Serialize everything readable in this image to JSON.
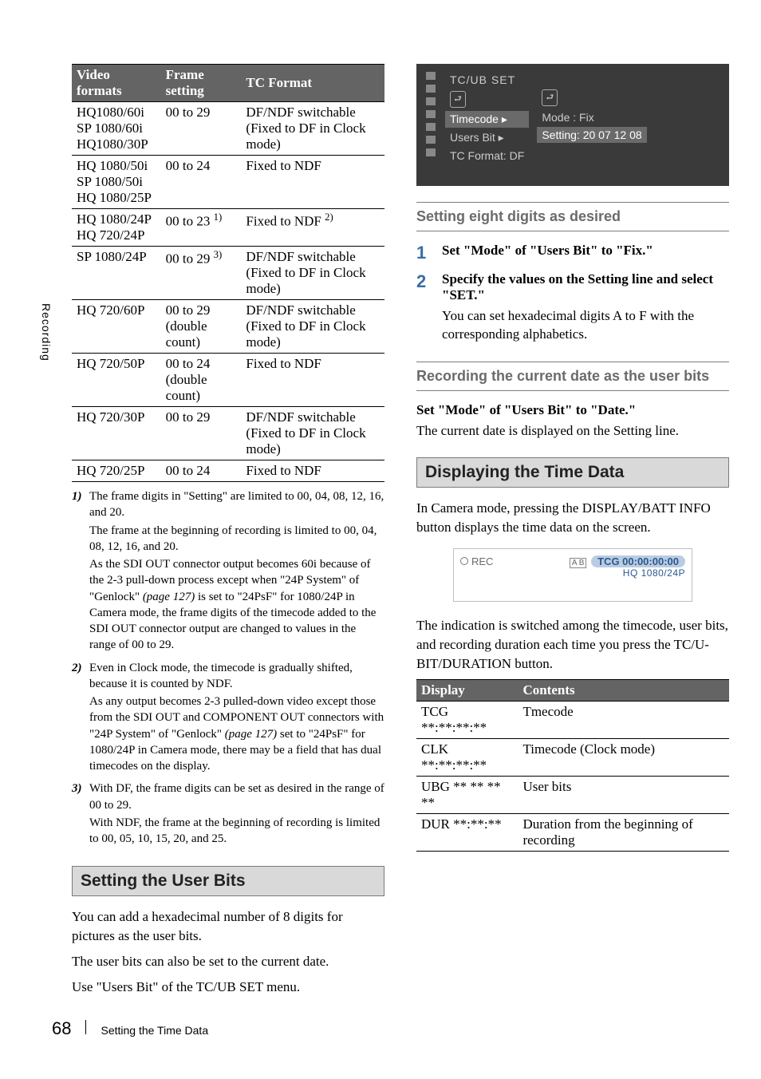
{
  "side_label": "Recording",
  "table1": {
    "headers": [
      "Video formats",
      "Frame setting",
      "TC Format"
    ],
    "rows": [
      {
        "c0": "HQ1080/60i\nSP 1080/60i\nHQ1080/30P",
        "c1": "00 to 29",
        "c2": "DF/NDF switchable\n(Fixed to DF in Clock mode)"
      },
      {
        "c0": "HQ 1080/50i\nSP 1080/50i\nHQ 1080/25P",
        "c1": "00 to 24",
        "c2": "Fixed to NDF"
      },
      {
        "c0": "HQ 1080/24P\nHQ 720/24P",
        "c1": "00 to 23",
        "c1_sup": "1)",
        "c2": "Fixed to NDF",
        "c2_sup": "2)"
      },
      {
        "c0": "SP 1080/24P",
        "c1": "00 to 29",
        "c1_sup": "3)",
        "c2": "DF/NDF switchable\n(Fixed to DF in Clock mode)"
      },
      {
        "c0": "HQ 720/60P",
        "c1": "00 to 29\n(double count)",
        "c2": "DF/NDF switchable\n(Fixed to DF in Clock mode)"
      },
      {
        "c0": "HQ 720/50P",
        "c1": "00 to 24\n(double count)",
        "c2": "Fixed to NDF"
      },
      {
        "c0": "HQ 720/30P",
        "c1": "00 to 29",
        "c2": "DF/NDF switchable\n(Fixed to DF in Clock mode)"
      },
      {
        "c0": "HQ 720/25P",
        "c1": "00 to 24",
        "c2": "Fixed to NDF"
      }
    ]
  },
  "footnotes": [
    {
      "num": "1)",
      "paras": [
        "The frame digits in \"Setting\" are limited to 00, 04, 08, 12, 16, and 20.",
        "The frame at the beginning of recording is limited to 00, 04, 08, 12, 16, and 20.",
        "As the SDI OUT connector output becomes 60i because of the 2-3 pull-down process except when \"24P System\" of \"Genlock\" (page 127) is set to \"24PsF\" for 1080/24P in Camera mode, the frame digits of the timecode added to the SDI OUT connector output are changed to values in the range of 00 to 29."
      ]
    },
    {
      "num": "2)",
      "paras": [
        "Even in Clock mode, the timecode is gradually shifted, because it is counted by NDF.",
        "As any output becomes 2-3 pulled-down video except those from the SDI OUT and COMPONENT OUT connectors with \"24P System\" of \"Genlock\" (page 127) set to \"24PsF\" for 1080/24P in Camera mode, there may be a field that has dual timecodes on the display."
      ]
    },
    {
      "num": "3)",
      "paras": [
        "With DF, the frame digits can be set as desired in the range of 00 to 29.",
        "With NDF, the frame at the beginning of recording is limited to 00, 05, 10, 15, 20, and 25."
      ]
    }
  ],
  "section_user_bits": {
    "title": "Setting the User Bits",
    "p1": "You can add a hexadecimal number of 8 digits for pictures as the user bits.",
    "p2": "The user bits can also be set to the current date.",
    "p3": "Use \"Users Bit\" of the TC/UB SET menu."
  },
  "camera_menu": {
    "title": "TC/UB SET",
    "left": [
      "⮐",
      "Timecode  ▸",
      "Users Bit ▸",
      "TC Format: DF"
    ],
    "right": [
      "⮐",
      "Mode    : Fix",
      "Setting: 20 07 12 08"
    ]
  },
  "subhead_eight": "Setting eight digits as desired",
  "steps": [
    {
      "num": "1",
      "head": "Set \"Mode\" of \"Users Bit\" to \"Fix.\""
    },
    {
      "num": "2",
      "head": "Specify the values on the Setting line and select \"SET.\"",
      "body": "You can set hexadecimal digits A to F with the corresponding alphabetics."
    }
  ],
  "subhead_record": "Recording the current date as the user bits",
  "record_block": {
    "line1": "Set \"Mode\" of \"Users Bit\" to \"Date.\"",
    "line2": "The current date is displayed on the Setting line."
  },
  "section_display": {
    "title": "Displaying the Time Data",
    "p1": "In Camera mode, pressing the DISPLAY/BATT INFO button displays the time data on the screen."
  },
  "display_box": {
    "rec": "REC",
    "ab": "A B",
    "tcg": "TCG 00:00:00:00",
    "mode": "HQ 1080/24P"
  },
  "display_switch_text": "The indication is switched among the timecode, user bits, and recording duration each time you press the TC/U-BIT/DURATION button.",
  "display_table": {
    "headers": [
      "Display",
      "Contents"
    ],
    "rows": [
      {
        "c0": "TCG **:**:**:**",
        "c1": "Tmecode"
      },
      {
        "c0": "CLK **:**:**:**",
        "c1": "Timecode (Clock mode)"
      },
      {
        "c0": "UBG ** ** ** **",
        "c1": "User bits"
      },
      {
        "c0": "DUR **:**:**",
        "c1": "Duration from the beginning of recording"
      }
    ]
  },
  "footer": {
    "page": "68",
    "title": "Setting the Time Data"
  }
}
